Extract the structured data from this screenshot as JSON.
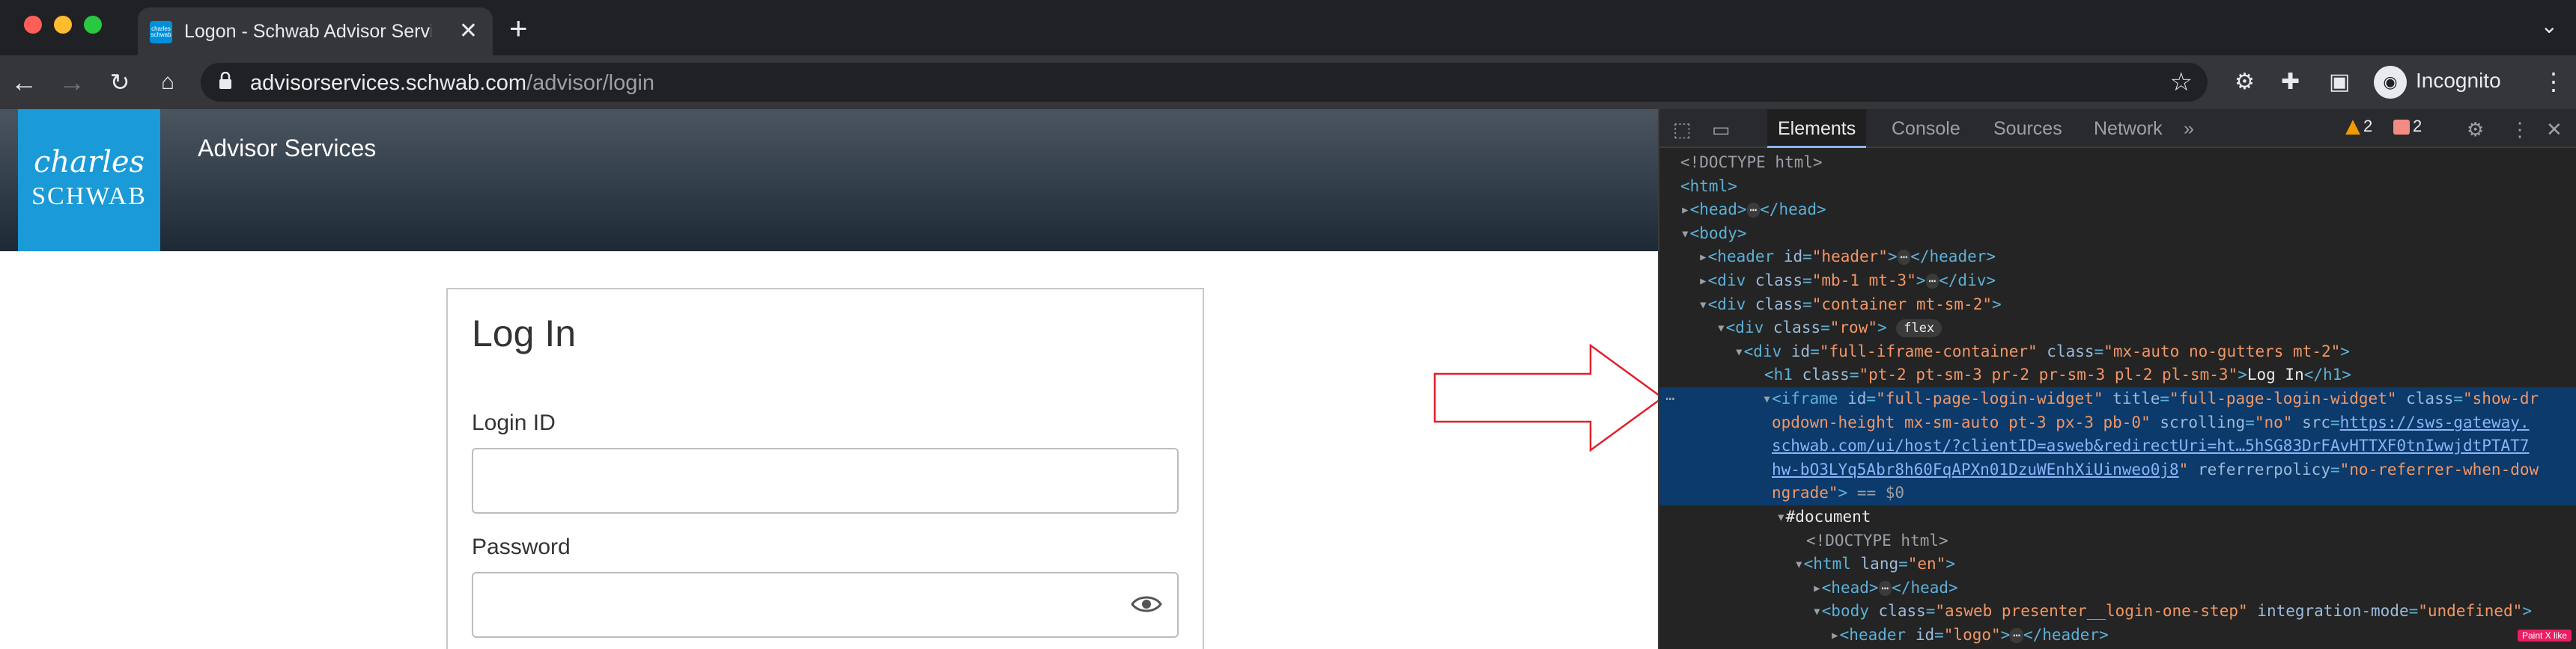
{
  "browser": {
    "tab_title": "Logon - Schwab Advisor Services",
    "favicon_text": "charles schwab",
    "url_host": "advisorservices.schwab.com",
    "url_path": "/advisor/login",
    "profile_label": "Incognito"
  },
  "site": {
    "logo_line1": "charles",
    "logo_line2": "SCHWAB",
    "title": "Advisor Services",
    "login": {
      "heading": "Log In",
      "login_id_label": "Login ID",
      "login_id_value": "",
      "password_label": "Password",
      "password_value": ""
    }
  },
  "devtools": {
    "tabs": [
      "Elements",
      "Console",
      "Sources",
      "Network"
    ],
    "more_tabs": "»",
    "warnings_count": "2",
    "errors_count": "2",
    "paint_badge": "Paint X like",
    "dom": {
      "l1": "<!DOCTYPE html>",
      "l2": "<html>",
      "l3_tag": "<head>",
      "l3_end": "</head>",
      "l4": "<body>",
      "l5_open": "<header",
      "l5_attr": "id",
      "l5_val": "\"header\"",
      "l5_end": "</header>",
      "l6_open": "<div",
      "l6_attr": "class",
      "l6_val": "\"mb-1 mt-3\"",
      "l6_end": "</div>",
      "l7_open": "<div",
      "l7_attr": "class",
      "l7_val": "\"container mt-sm-2\"",
      "l8_open": "<div",
      "l8_attr": "class",
      "l8_val": "\"row\"",
      "l8_pill": "flex",
      "l9_open": "<div",
      "l9_attr1": "id",
      "l9_val1": "\"full-iframe-container\"",
      "l9_attr2": "class",
      "l9_val2": "\"mx-auto no-gutters mt-2\"",
      "l10_open": "<h1",
      "l10_attr": "class",
      "l10_val": "\"pt-2 pt-sm-3 pr-2 pr-sm-3 pl-2 pl-sm-3\"",
      "l10_text": "Log In",
      "l10_end": "</h1>",
      "l11_open": "<iframe",
      "l11_attr1": "id",
      "l11_val1": "\"full-page-login-widget\"",
      "l11_attr2": "title",
      "l11_val2": "\"full-page-login-widget\"",
      "l11_attr3": "class",
      "l11_val3": "\"show-dr",
      "l12_val": "opdown-height mx-sm-auto pt-3 px-3 pb-0\"",
      "l12_attr": "scrolling",
      "l12_val2": "\"no\"",
      "l12_attr2": "src",
      "l12_link": "https://sws-gateway.",
      "l13_link": "schwab.com/ui/host/?clientID=asweb&redirectUri=ht…5hSG83DrFAvHTTXF0tnIwwjdtPTAT7",
      "l14_link": "hw-bO3LYq5Abr8h60FqAPXn01DzuWEnhXiUinweo0j8",
      "l14_attr": "referrerpolicy",
      "l14_val": "\"no-referrer-when-dow",
      "l15_val": "ngrade\"",
      "l15_eq": "== $0",
      "l16": "#document",
      "l17": "<!DOCTYPE html>",
      "l18_open": "<html",
      "l18_attr": "lang",
      "l18_val": "\"en\"",
      "l19_tag": "<head>",
      "l19_end": "</head>",
      "l20_open": "<body",
      "l20_attr": "class",
      "l20_val": "\"asweb presenter__login-one-step\"",
      "l20_attr2": "integration-mode",
      "l20_val2": "\"undefined\"",
      "l21_open": "<header",
      "l21_attr": "id",
      "l21_val": "\"logo\"",
      "l21_end": "</header>"
    }
  },
  "colors": {
    "logo_blue": "#1a9ad7",
    "annotation_red": "#e0202a",
    "selected_row": "#0b3a6b"
  }
}
